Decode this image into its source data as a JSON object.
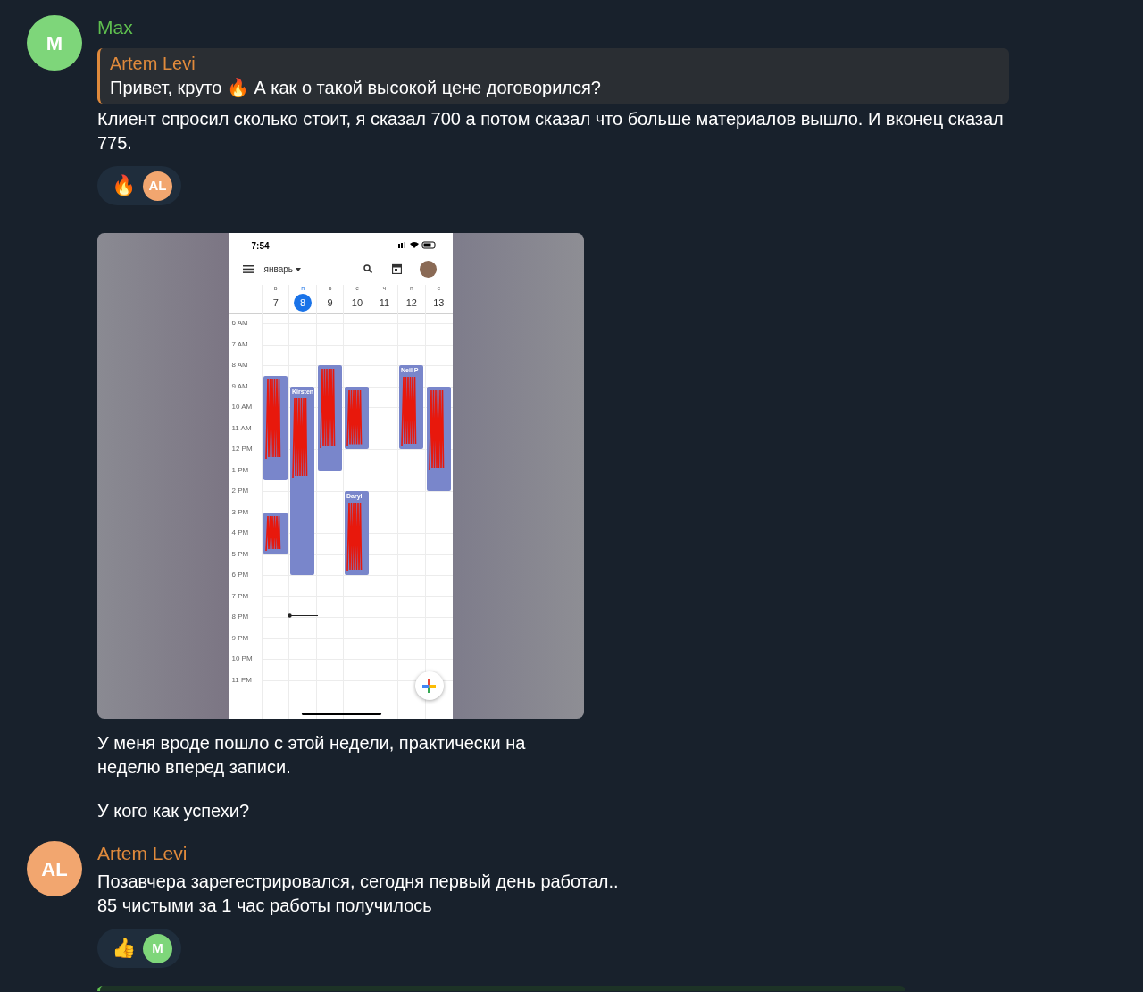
{
  "messages": [
    {
      "sender": "Max",
      "avatar": "M",
      "color": "#7ed67a",
      "reply": {
        "author": "Artem Levi",
        "text": "Привет, круто 🔥 А как о такой высокой цене договорился?"
      },
      "texts": [
        "Клиент спросил сколько стоит, я сказал 700 а потом сказал что больше материалов вышло. И вконец сказал 775."
      ],
      "reaction": {
        "emoji": "🔥",
        "avatar": "AL",
        "color": "#f2a66f"
      }
    },
    {
      "kind": "photo",
      "phone": {
        "time": "7:54",
        "month": "январь",
        "days": [
          {
            "letter": "в",
            "number": "7",
            "selected": false,
            "events": [
              {
                "scribbled": true
              },
              {
                "scribbled": true
              }
            ]
          },
          {
            "letter": "п",
            "number": "8",
            "selected": true,
            "events": [
              {
                "label": "Kirsten",
                "scribbled": true
              }
            ]
          },
          {
            "letter": "в",
            "number": "9",
            "selected": false,
            "events": [
              {
                "scribbled": true
              }
            ]
          },
          {
            "letter": "с",
            "number": "10",
            "selected": false,
            "events": [
              {
                "scribbled": true
              },
              {
                "label": "Daryl",
                "scribbled": true
              }
            ]
          },
          {
            "letter": "ч",
            "number": "11",
            "selected": false
          },
          {
            "letter": "п",
            "number": "12",
            "selected": false,
            "events": [
              {
                "label": "Neil P",
                "scribbled": true
              }
            ]
          },
          {
            "letter": "с",
            "number": "13",
            "selected": false,
            "events": [
              {
                "scribbled": true
              }
            ]
          }
        ],
        "hours": [
          "6 AM",
          "7 AM",
          "8 AM",
          "9 AM",
          "10 AM",
          "11 AM",
          "12 PM",
          "1 PM",
          "2 PM",
          "3 PM",
          "4 PM",
          "5 PM",
          "6 PM",
          "7 PM",
          "8 PM",
          "9 PM",
          "10 PM",
          "11 PM"
        ]
      },
      "texts": [
        "У меня вроде пошло с этой недели, практически на неделю вперед записи.",
        "У кого как успехи?"
      ]
    },
    {
      "sender": "Artem Levi",
      "avatar": "AL",
      "color": "#f2a66f",
      "texts": [
        "Позавчера зарегестрировался, сегодня первый день работал..\n85 чистыми за 1 час работы получилось"
      ],
      "reaction": {
        "emoji": "👍",
        "avatar": "M",
        "color": "#7ed67a"
      }
    }
  ]
}
